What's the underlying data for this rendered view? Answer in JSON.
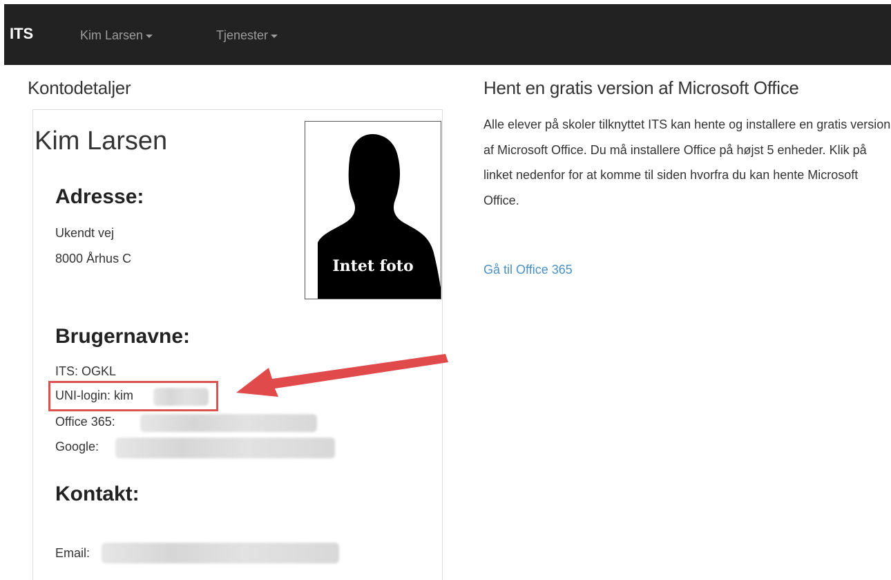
{
  "navbar": {
    "brand": "ITS",
    "items": [
      {
        "label": "Kim Larsen"
      },
      {
        "label": "Tjenester"
      }
    ]
  },
  "account": {
    "section_title": "Kontodetaljer",
    "name": "Kim Larsen",
    "photo_caption": "Intet foto",
    "address": {
      "heading": "Adresse:",
      "lines": [
        "Ukendt vej",
        "8000 Århus C"
      ]
    },
    "usernames": {
      "heading": "Brugernavne:",
      "its": "ITS: OGKL",
      "uni_login": "UNI-login: kim",
      "office365_label": "Office 365:",
      "google_label": "Google:"
    },
    "contact": {
      "heading": "Kontakt:",
      "email_label": "Email:"
    }
  },
  "office": {
    "title": "Hent en gratis version af Microsoft Office",
    "body": "Alle elever på skoler tilknyttet ITS kan hente og installere en gratis version af Microsoft Office. Du må installere Office på højst 5 enheder. Klik på linket nedenfor for at komme til siden hvorfra du kan hente Microsoft Office.",
    "link_label": "Gå til Office 365"
  },
  "colors": {
    "navbar_bg": "#222222",
    "nav_text": "#9d9d9d",
    "link": "#4a90c8",
    "annotation": "#d9534f"
  },
  "icons": {
    "nav_caret": "chevron-down-icon",
    "photo": "person-silhouette-icon",
    "annotation": "arrow-icon"
  }
}
